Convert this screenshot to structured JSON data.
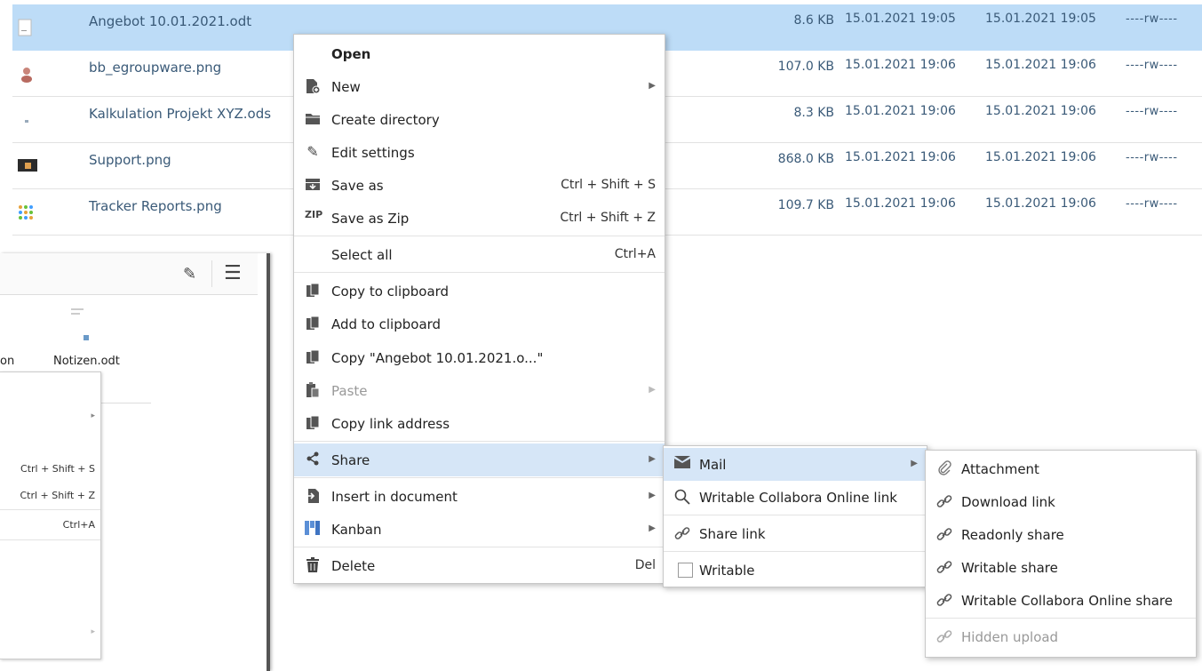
{
  "files": [
    {
      "name": "Angebot 10.01.2021.odt",
      "size": "8.6 KB",
      "modified": "15.01.2021 19:05",
      "created": "15.01.2021 19:05",
      "perms": "----rw----",
      "selected": true
    },
    {
      "name": "bb_egroupware.png",
      "size": "107.0 KB",
      "modified": "15.01.2021 19:06",
      "created": "15.01.2021 19:06",
      "perms": "----rw----"
    },
    {
      "name": "Kalkulation Projekt XYZ.ods",
      "size": "8.3 KB",
      "modified": "15.01.2021 19:06",
      "created": "15.01.2021 19:06",
      "perms": "----rw----"
    },
    {
      "name": "Support.png",
      "size": "868.0 KB",
      "modified": "15.01.2021 19:06",
      "created": "15.01.2021 19:06",
      "perms": "----rw----"
    },
    {
      "name": "Tracker Reports.png",
      "size": "109.7 KB",
      "modified": "15.01.2021 19:06",
      "created": "15.01.2021 19:06",
      "perms": "----rw----"
    }
  ],
  "bg_window": {
    "file_label_1": "on",
    "file_label_2": "Notizen.odt",
    "ctx": {
      "shortcut_save_as": "Ctrl + Shift + S",
      "shortcut_save_zip": "Ctrl + Shift + Z",
      "shortcut_select_all": "Ctrl+A"
    }
  },
  "context_menu": {
    "open": "Open",
    "new": "New",
    "create_directory": "Create directory",
    "edit_settings": "Edit settings",
    "save_as": "Save as",
    "save_as_shortcut": "Ctrl + Shift + S",
    "save_as_zip": "Save as Zip",
    "save_as_zip_shortcut": "Ctrl + Shift + Z",
    "select_all": "Select all",
    "select_all_shortcut": "Ctrl+A",
    "copy_to_clipboard": "Copy to clipboard",
    "add_to_clipboard": "Add to clipboard",
    "copy_name": "Copy \"Angebot 10.01.2021.o...\"",
    "paste": "Paste",
    "copy_link_address": "Copy link address",
    "share": "Share",
    "insert_in_document": "Insert in document",
    "kanban": "Kanban",
    "delete": "Delete",
    "delete_shortcut": "Del"
  },
  "share_menu": {
    "mail": "Mail",
    "writable_collabora_link": "Writable Collabora Online link",
    "share_link": "Share link",
    "writable": "Writable"
  },
  "mail_menu": {
    "attachment": "Attachment",
    "download_link": "Download link",
    "readonly_share": "Readonly share",
    "writable_share": "Writable share",
    "writable_collabora_share": "Writable Collabora Online share",
    "hidden_upload": "Hidden upload"
  },
  "colors": {
    "selection": "#bddcf7",
    "menu_highlight": "#d6e6f7",
    "link_text": "#3a5a78"
  }
}
